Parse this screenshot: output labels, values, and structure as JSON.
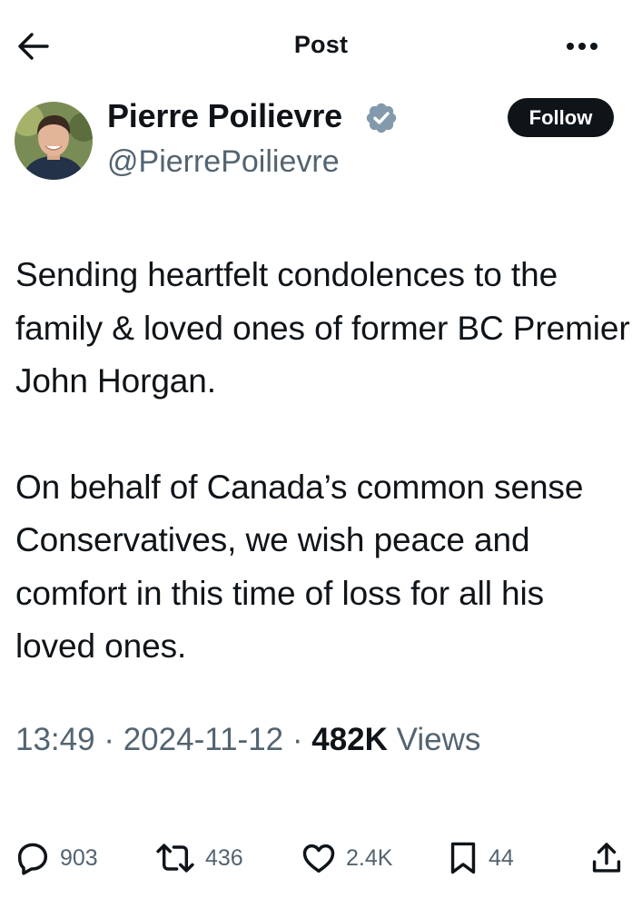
{
  "header": {
    "title": "Post",
    "back_icon": "arrow-left-icon",
    "more_icon": "more-horizontal-icon"
  },
  "author": {
    "name": "Pierre Poilievre",
    "handle": "@PierrePoilievre",
    "verified": true,
    "verified_color": "#829aab",
    "follow_label": "Follow"
  },
  "post": {
    "paragraphs": [
      "Sending heartfelt condolences to the family & loved ones of former BC Premier John Horgan.",
      "On behalf of Canada’s common sense Conservatives, we wish peace and comfort in this time of loss for all his loved ones."
    ],
    "time": "13:49",
    "date": "2024-11-12",
    "separator": " · ",
    "views_count": "482K",
    "views_label": " Views"
  },
  "actions": {
    "replies": {
      "icon": "reply-icon",
      "count": "903"
    },
    "reposts": {
      "icon": "repost-icon",
      "count": "436"
    },
    "likes": {
      "icon": "heart-icon",
      "count": "2.4K"
    },
    "bookmarks": {
      "icon": "bookmark-icon",
      "count": "44"
    },
    "share": {
      "icon": "share-icon"
    }
  },
  "colors": {
    "text": "#0f1419",
    "secondary": "#536471",
    "follow_bg": "#0f1419"
  }
}
